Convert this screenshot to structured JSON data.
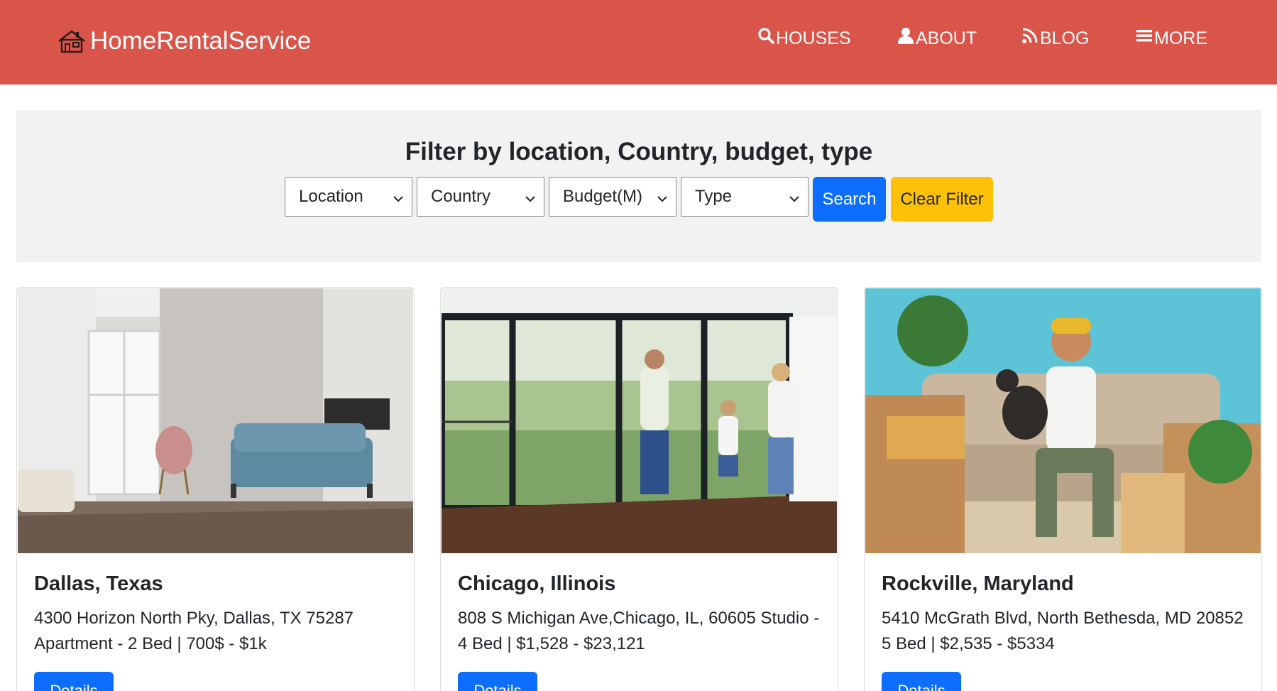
{
  "header": {
    "brand": "HomeRentalService",
    "nav": [
      {
        "label": "HOUSES",
        "icon": "search-icon"
      },
      {
        "label": "ABOUT",
        "icon": "user-icon"
      },
      {
        "label": "BLOG",
        "icon": "rss-icon"
      },
      {
        "label": "MORE",
        "icon": "menu-icon"
      }
    ]
  },
  "filter": {
    "title": "Filter by location, Country, budget, type",
    "selects": [
      "Location",
      "Country",
      "Budget(M)",
      "Type"
    ],
    "search_label": "Search",
    "clear_label": "Clear Filter"
  },
  "cards": [
    {
      "title": "Dallas, Texas",
      "text": "4300 Horizon North Pky, Dallas, TX 75287 Apartment - 2 Bed | 700$ - $1k",
      "button": "Details"
    },
    {
      "title": "Chicago, Illinois",
      "text": "808 S Michigan Ave,Chicago, IL, 60605 Studio - 4 Bed | $1,528 - $23,121",
      "button": "Details"
    },
    {
      "title": "Rockville, Maryland",
      "text": "5410 McGrath Blvd, North Bethesda, MD 20852 5 Bed | $2,535 - $5334",
      "button": "Details"
    }
  ],
  "colors": {
    "header_bg": "#d9554a",
    "filter_bg": "#f2f2f2",
    "primary": "#0d6efd",
    "warning": "#ffc107"
  }
}
